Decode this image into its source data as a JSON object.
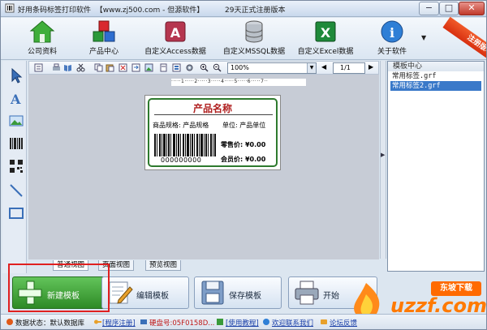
{
  "window": {
    "title": "好用条码标签打印软件  【www.zj500.com - 但源软件】         29天正式注册版本",
    "controls": {
      "minimize": "−",
      "maximize": "□",
      "close": "✕"
    }
  },
  "main_toolbar": {
    "items": [
      {
        "label": "公司资料",
        "icon": "house-icon"
      },
      {
        "label": "产品中心",
        "icon": "cubes-icon"
      },
      {
        "label": "自定义Access数据",
        "icon": "access-key-icon"
      },
      {
        "label": "自定义MSSQL数据",
        "icon": "database-icon"
      },
      {
        "label": "自定义Excel数据",
        "icon": "excel-icon"
      },
      {
        "label": "关于软件",
        "icon": "info-icon"
      }
    ],
    "more": "▼",
    "ribbon": "注册版本"
  },
  "edit_toolbar": {
    "zoom": "100%",
    "page": "1/1",
    "first": "◀",
    "next": "▶"
  },
  "ruler": "·····1·····2·····3·····4·····5·····6·····7··",
  "label": {
    "product_name": "产品名称",
    "spec": "商品规格: 产品规格",
    "unit": "单位: 产品单位",
    "barcode_number": "000000000",
    "sale_price": "零售价: ¥0.00",
    "member_price": "会员价: ¥0.00"
  },
  "template_panel": {
    "title": "模板中心",
    "items": [
      "常用标签.grf",
      "常用标签2.grf"
    ]
  },
  "view_tabs": [
    "普通视图",
    "页面视图",
    "预览视图"
  ],
  "actions": {
    "new": "新建模板",
    "edit": "编辑模板",
    "save": "保存模板",
    "print": "开始"
  },
  "status_bar": {
    "db_status": "数据状态：默认数据库",
    "register": "[程序注册]",
    "disk": "硬盘号:05F0158D...",
    "tutorial": "[使用教程]",
    "contact": "欢迎联系我们",
    "forum": "论坛反馈"
  },
  "watermark": {
    "badge": "东坡下载",
    "text": "uzzf.com"
  }
}
